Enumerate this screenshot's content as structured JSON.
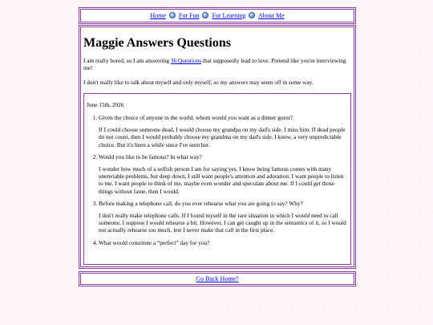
{
  "nav": {
    "links": [
      {
        "label": "Home",
        "icon": "orb-icon"
      },
      {
        "label": "For Fun",
        "icon": "orb-icon"
      },
      {
        "label": "For Learning",
        "icon": "orb-icon"
      },
      {
        "label": "About Me",
        "icon": "orb-icon"
      }
    ]
  },
  "page": {
    "title": "Maggie Answers Questions",
    "intro_before_link": "I am really bored, so I am answering ",
    "intro_link": "36 Questions",
    "intro_after_link": " that supposedly lead to love. Pretend like you're interviewing me!",
    "intro2": "I don't really like to talk about myself and only myself, so my answers may seem off in some way."
  },
  "qa": {
    "date": "June 15th, 2026",
    "items": [
      {
        "question": "Given the choice of anyone in the world, whom would you want as a dinner guest?",
        "answer": "If I could choose someone dead, I would choose my grandpa on my dad's side. I miss him. If dead people do not count, then I would probably choose my grandma on my dad's side. I know, a very unpredictable choice. But it's been a while since I've seen her."
      },
      {
        "question": "Would you like to be famous? In what way?",
        "answer": "I wonder how much of a selfish person I am for saying yes. I know being famous comes with many unenviable problems, but deep down, I still want people's attention and adoration. I want people to listen to me. I want people to think of me, maybe even wonder and speculate about me. If I could get those things without fame, then I would."
      },
      {
        "question": "Before making a telephone call, do you ever rehearse what you are going to say? Why?",
        "answer": "I don't really make telephone calls. If I found myself in the rare situation in which I would need to call someone, I suppose I would rehearse a bit. However, I can get caught up in the semantics of it, so I would not actually rehearse too much, lest I never make that call in the first place."
      },
      {
        "question": "What would constitute a “perfect” day for you?",
        "answer": ""
      }
    ]
  },
  "footer": {
    "link": "Go Back Home?"
  },
  "colors": {
    "background": "#fbc8e4",
    "border": "#8a3fa0",
    "link": "#0000ee"
  }
}
